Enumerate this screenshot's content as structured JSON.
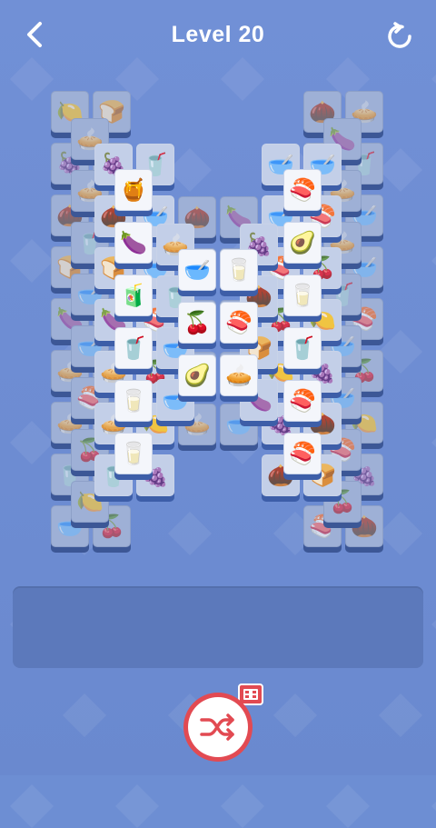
{
  "header": {
    "title": "Level 20",
    "back_icon": "chevron-left-icon",
    "restart_icon": "restart-icon"
  },
  "colors": {
    "background": "#6d8ed3",
    "tile_face": "#f4f6fb",
    "tile_edge": "#3d5ea8",
    "accent_red": "#e24a52"
  },
  "board": {
    "top_layer_left": [
      "jam-jar",
      "eggplant",
      "juice-glass",
      "grape-juice",
      "milk-carton",
      "milk-carton"
    ],
    "top_layer_center_left": [
      "bowl",
      "cherries",
      "avocado"
    ],
    "top_layer_center_right": [
      "milk-carton",
      "salmon",
      "pie"
    ],
    "top_layer_right": [
      "salmon",
      "avocado",
      "milk-carton",
      "grape-juice",
      "salmon",
      "salmon"
    ]
  },
  "tray": {
    "slots_filled": 0
  },
  "actions": {
    "shuffle_icon": "shuffle-icon",
    "video_icon": "video-ad-icon"
  }
}
